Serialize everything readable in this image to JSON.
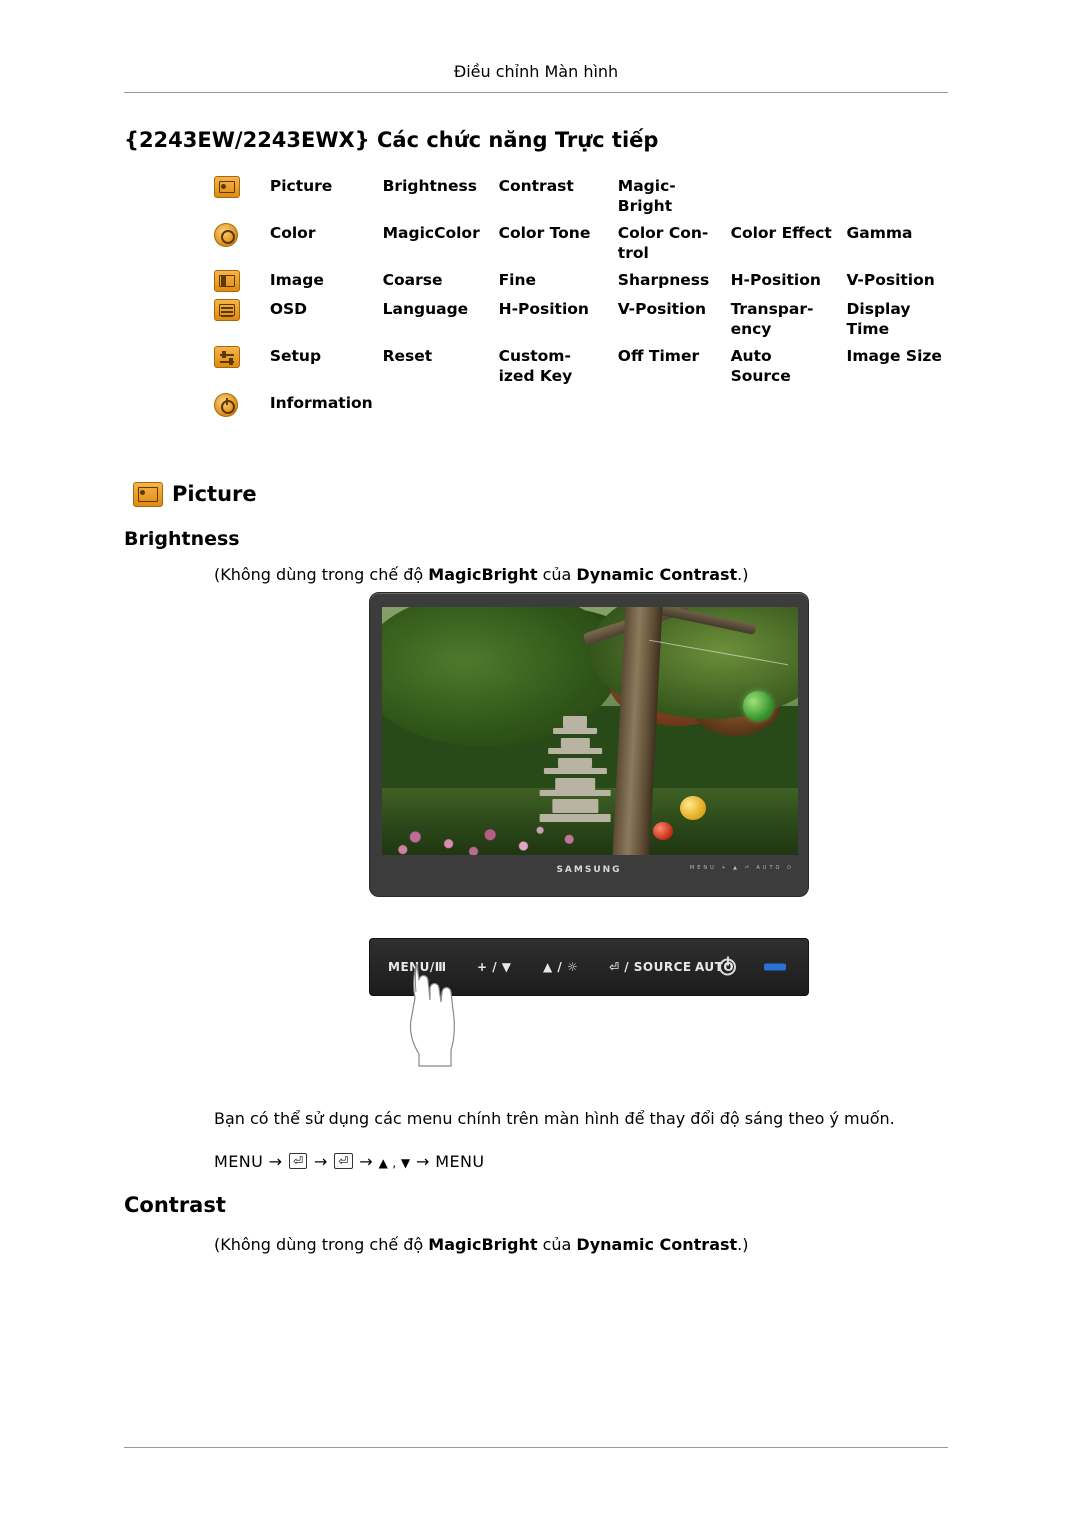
{
  "header": {
    "running_title": "Điều chỉnh Màn hình"
  },
  "title": "{2243EW/2243EWX} Các chức năng Trực tiếp",
  "function_table": {
    "rows": [
      {
        "icon": "picture-icon",
        "label": "Picture",
        "cells": [
          "Brightness",
          "Contrast",
          "Magic-\nBright",
          "",
          ""
        ]
      },
      {
        "icon": "color-icon",
        "label": "Color",
        "cells": [
          "MagicColor",
          "Color Tone",
          "Color  Con-\ntrol",
          "Color Effect",
          "Gamma"
        ]
      },
      {
        "icon": "image-icon",
        "label": "Image",
        "cells": [
          "Coarse",
          "Fine",
          "Sharpness",
          "H-Position",
          "V-Position"
        ]
      },
      {
        "icon": "osd-icon",
        "label": "OSD",
        "cells": [
          "Language",
          "H-Position",
          "V-Position",
          "Transpar-\nency",
          "Display\nTime"
        ]
      },
      {
        "icon": "setup-icon",
        "label": "Setup",
        "cells": [
          "Reset",
          "Custom-\nized Key",
          "Off Timer",
          "Auto\nSource",
          "Image Size"
        ]
      },
      {
        "icon": "information-icon",
        "label": "Information",
        "cells": [
          "",
          "",
          "",
          "",
          ""
        ]
      }
    ]
  },
  "section": {
    "picture_heading": "Picture",
    "brightness_heading": "Brightness",
    "brightness_note_prefix": "(Không dùng trong chế độ ",
    "brightness_note_b1": "MagicBright",
    "brightness_note_mid": " của ",
    "brightness_note_b2": "Dynamic Contrast",
    "brightness_note_suffix": ".)",
    "contrast_heading": "Contrast",
    "contrast_note_prefix": "(Không dùng trong chế độ ",
    "contrast_note_b1": "MagicBright",
    "contrast_note_mid": " của ",
    "contrast_note_b2": "Dynamic Contrast",
    "contrast_note_suffix": ".)"
  },
  "monitor": {
    "brand": "SAMSUNG",
    "button_marks": "MENU  +  ▲  ⏎  AUTO  ⏻"
  },
  "control_panel": {
    "menu_label": "MENU/Ⅲ",
    "btn2_label": "+ / ▼",
    "btn3_label": "▲ / ☼",
    "btn4_label": "⏎ / SOURCE",
    "btn5_label": "AUTO"
  },
  "body_text": {
    "paragraph": "Bạn có thể sử dụng các menu chính trên màn hình để thay đổi độ sáng theo ý muốn.",
    "menu_path_start": "MENU →",
    "menu_path_key1": "⏎",
    "menu_path_arrow1": "→",
    "menu_path_key2": "⏎",
    "menu_path_arrow2": "→",
    "menu_path_updown": "▲ , ▼",
    "menu_path_end": "→ MENU"
  },
  "colors": {
    "icon_orange": "#e08a12",
    "icon_dark": "#5a3a00",
    "rule": "#999999",
    "led_blue": "#2b6fd8"
  }
}
